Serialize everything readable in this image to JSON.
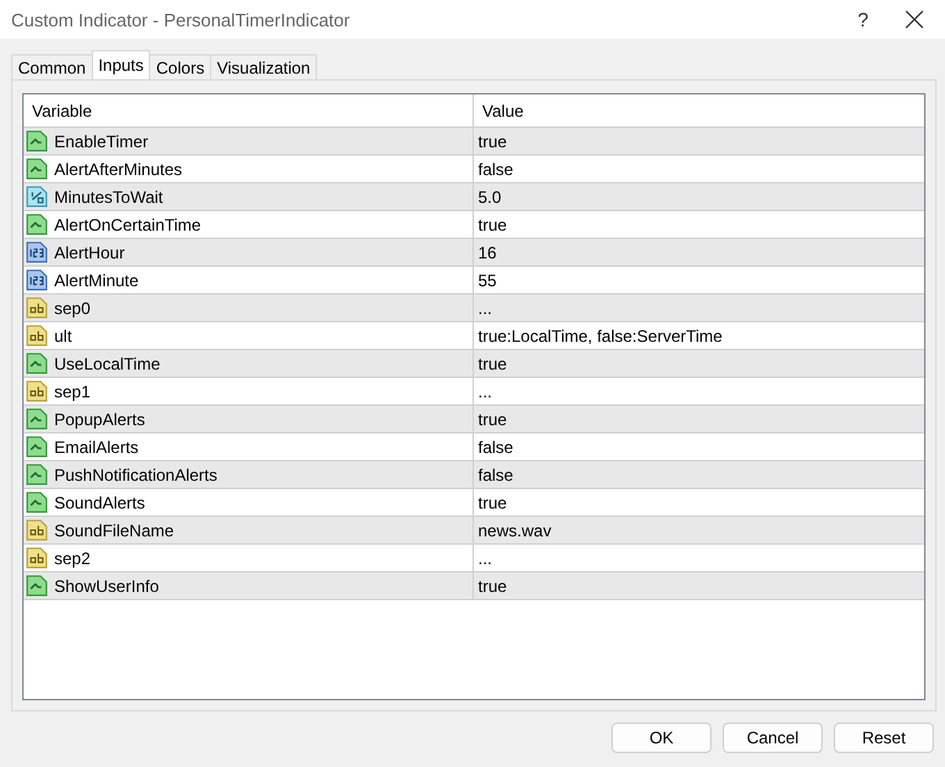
{
  "window": {
    "title": "Custom Indicator - PersonalTimerIndicator",
    "help": "?"
  },
  "tabs": [
    {
      "label": "Common",
      "selected": false
    },
    {
      "label": "Inputs",
      "selected": true
    },
    {
      "label": "Colors",
      "selected": false
    },
    {
      "label": "Visualization",
      "selected": false
    }
  ],
  "table": {
    "columns": [
      "Variable",
      "Value"
    ],
    "rows": [
      {
        "kind": "bool",
        "variable": "EnableTimer",
        "value": "true"
      },
      {
        "kind": "bool",
        "variable": "AlertAfterMinutes",
        "value": "false"
      },
      {
        "kind": "double",
        "variable": "MinutesToWait",
        "value": "5.0"
      },
      {
        "kind": "bool",
        "variable": "AlertOnCertainTime",
        "value": "true"
      },
      {
        "kind": "int",
        "variable": "AlertHour",
        "value": "16"
      },
      {
        "kind": "int",
        "variable": "AlertMinute",
        "value": "55"
      },
      {
        "kind": "string",
        "variable": "sep0",
        "value": "..."
      },
      {
        "kind": "string",
        "variable": "ult",
        "value": "true:LocalTime, false:ServerTime"
      },
      {
        "kind": "bool",
        "variable": "UseLocalTime",
        "value": "true"
      },
      {
        "kind": "string",
        "variable": "sep1",
        "value": "..."
      },
      {
        "kind": "bool",
        "variable": "PopupAlerts",
        "value": "true"
      },
      {
        "kind": "bool",
        "variable": "EmailAlerts",
        "value": "false"
      },
      {
        "kind": "bool",
        "variable": "PushNotificationAlerts",
        "value": "false"
      },
      {
        "kind": "bool",
        "variable": "SoundAlerts",
        "value": "true"
      },
      {
        "kind": "string",
        "variable": "SoundFileName",
        "value": "news.wav"
      },
      {
        "kind": "string",
        "variable": "sep2",
        "value": "..."
      },
      {
        "kind": "bool",
        "variable": "ShowUserInfo",
        "value": "true"
      }
    ]
  },
  "buttons": [
    "OK",
    "Cancel",
    "Reset"
  ]
}
